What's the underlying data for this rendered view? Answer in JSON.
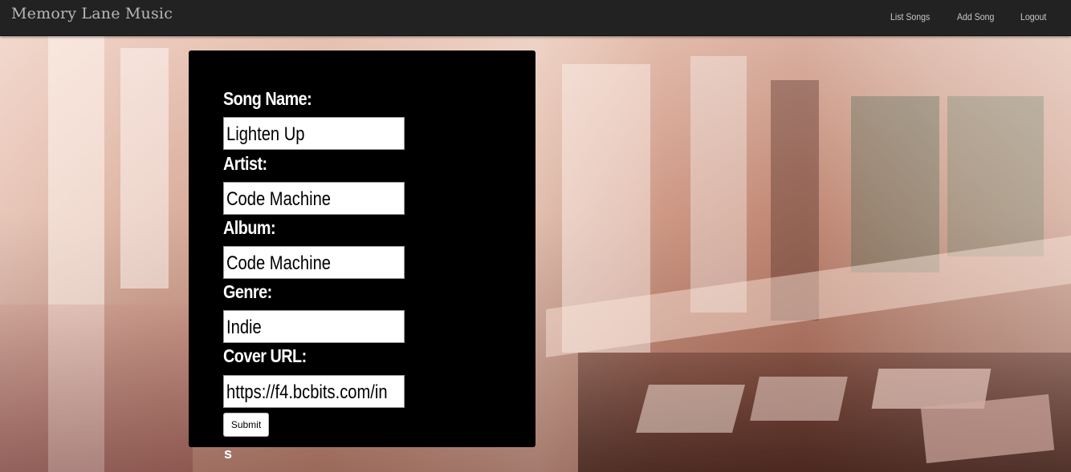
{
  "navbar": {
    "brand": "Memory Lane Music",
    "links": [
      {
        "label": "List Songs"
      },
      {
        "label": "Add Song"
      },
      {
        "label": "Logout"
      }
    ]
  },
  "form": {
    "fields": [
      {
        "label": "Song Name:",
        "value": "Lighten Up"
      },
      {
        "label": "Artist:",
        "value": "Code Machine"
      },
      {
        "label": "Album:",
        "value": "Code Machine"
      },
      {
        "label": "Genre:",
        "value": "Indie"
      },
      {
        "label": "Cover URL:",
        "value": "https://f4.bcbits.com/in"
      }
    ],
    "submit_label": "Submit"
  },
  "stray_text": "s",
  "colors": {
    "navbar_bg": "#222222",
    "panel_bg": "#000000",
    "nav_text": "#c8c8c8"
  }
}
